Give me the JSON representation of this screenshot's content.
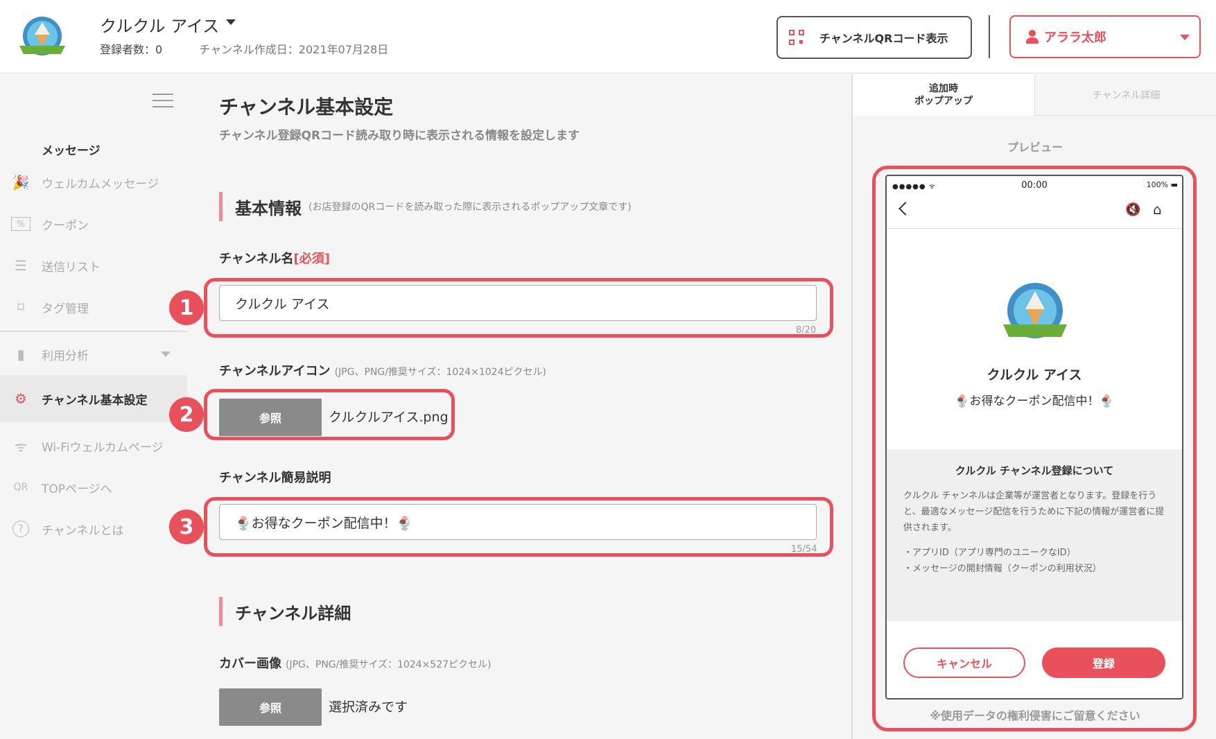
{
  "header": {
    "channel_title": "クルクル アイス",
    "subscribers": "登録者数：0",
    "created": "チャンネル作成日：2021年07月28日",
    "qr_button": "チャンネルQRコード表示",
    "user_name": "アララ太郎"
  },
  "sidebar": {
    "section": "メッセージ",
    "items": [
      {
        "label": "ウェルカムメッセージ",
        "icon": "party-popper-icon"
      },
      {
        "label": "クーポン",
        "icon": "coupon-icon"
      },
      {
        "label": "送信リスト",
        "icon": "list-icon"
      },
      {
        "label": "タグ管理",
        "icon": "tag-icon"
      },
      {
        "label": "利用分析",
        "icon": "bar-chart-icon"
      },
      {
        "label": "チャンネル基本設定",
        "icon": "gear-icon"
      },
      {
        "label": "Wi-Fiウェルカムページ",
        "icon": "wifi-icon"
      },
      {
        "label": "TOPページへ",
        "icon": "qr-icon"
      },
      {
        "label": "チャンネルとは",
        "icon": "help-icon"
      }
    ]
  },
  "main": {
    "title": "チャンネル基本設定",
    "subtitle": "チャンネル登録QRコード読み取り時に表示される情報を設定します",
    "basic": {
      "heading": "基本情報",
      "heading_note": "(お店登録のQRコードを読み取った際に表示されるポップアップ文章です)",
      "name_label": "チャンネル名",
      "name_required": "[必須]",
      "name_value": "クルクル アイス",
      "name_counter": "8/20",
      "icon_label": "チャンネルアイコン",
      "icon_hint": "(JPG、PNG/推奨サイズ：1024×1024ピクセル)",
      "browse": "参照",
      "icon_file": "クルクルアイス.png",
      "desc_label": "チャンネル簡易説明",
      "desc_value": "🍨お得なクーポン配信中！🍨",
      "desc_counter": "15/54"
    },
    "detail": {
      "heading": "チャンネル詳細",
      "cover_label": "カバー画像",
      "cover_hint": "(JPG、PNG/推奨サイズ：1024×527ピクセル)",
      "browse": "参照",
      "cover_file": "選択済みです"
    },
    "badges": [
      "1",
      "2",
      "3"
    ]
  },
  "preview": {
    "tab_popup_line1": "追加時",
    "tab_popup_line2": "ポップアップ",
    "tab_detail": "チャンネル詳細",
    "label": "プレビュー",
    "status_time": "00:00",
    "status_battery": "100%",
    "status_signal": "●●●●● ᯤ",
    "channel_name": "クルクル アイス",
    "channel_desc": "🍨お得なクーポン配信中！🍨",
    "info_title": "クルクル チャンネル登録について",
    "info_body": "クルクル チャンネルは企業等が運営者となります。登録を行うと、最適なメッセージ配信を行うために下記の情報が運営者に提供されます。",
    "info_bullet1": "・アプリID（アプリ専門のユニークなID）",
    "info_bullet2": "・メッセージの開封情報（クーポンの利用状況）",
    "cancel": "キャンセル",
    "register": "登録",
    "note": "※使用データの権利侵害にご留意ください"
  },
  "colors": {
    "accent": "#e8505b",
    "accent_light": "#f08a95",
    "sidebar_bg": "#f5f5f5"
  }
}
